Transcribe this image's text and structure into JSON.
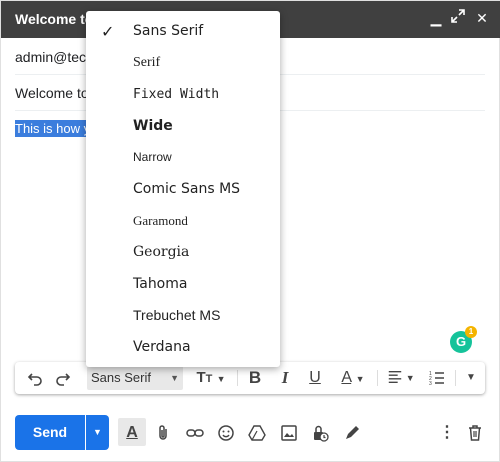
{
  "window": {
    "title": "Welcome to",
    "controls": [
      "minimize-icon",
      "expand-icon",
      "close-icon"
    ]
  },
  "compose": {
    "to_value": "admin@tech",
    "subject_value": "Welcome to",
    "body_selected_text": "This is how y"
  },
  "grammarly": {
    "badge_count": "1",
    "letter": "G"
  },
  "toolbar": {
    "font_selected": "Sans Serif",
    "icons": [
      "undo-icon",
      "redo-icon",
      "text-size-icon",
      "bold-icon",
      "italic-icon",
      "underline-icon",
      "text-color-icon",
      "align-icon",
      "numbered-list-icon",
      "more-formatting-icon"
    ]
  },
  "font_menu": {
    "items": [
      {
        "label": "Sans Serif",
        "checked": true
      },
      {
        "label": "Serif",
        "checked": false
      },
      {
        "label": "Fixed Width",
        "checked": false
      },
      {
        "label": "Wide",
        "checked": false
      },
      {
        "label": "Narrow",
        "checked": false
      },
      {
        "label": "Comic Sans MS",
        "checked": false
      },
      {
        "label": "Garamond",
        "checked": false
      },
      {
        "label": "Georgia",
        "checked": false
      },
      {
        "label": "Tahoma",
        "checked": false
      },
      {
        "label": "Trebuchet MS",
        "checked": false
      },
      {
        "label": "Verdana",
        "checked": false
      }
    ]
  },
  "bottom_bar": {
    "send_label": "Send",
    "icons": [
      "formatting-options-icon",
      "attach-icon",
      "link-icon",
      "emoji-icon",
      "drive-icon",
      "photo-icon",
      "confidential-mode-icon",
      "signature-icon",
      "more-options-icon",
      "discard-icon"
    ]
  },
  "colors": {
    "titlebar": "#404040",
    "send_button": "#1a73e8",
    "selection": "#3b7ddd",
    "grammarly": "#15c39a"
  }
}
